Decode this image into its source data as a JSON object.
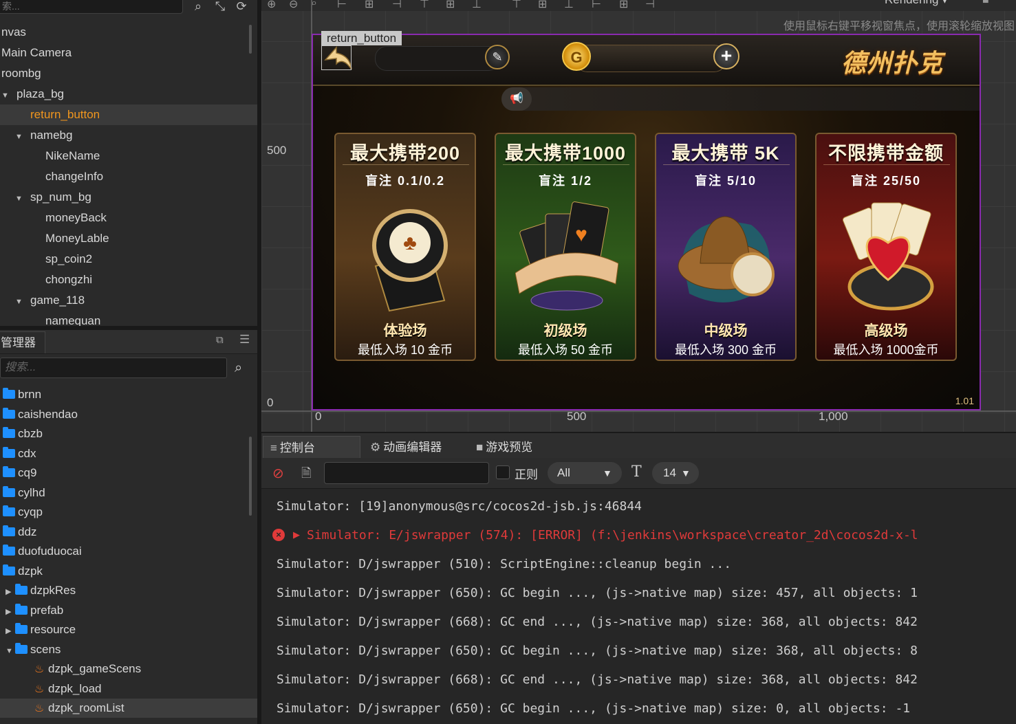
{
  "hierarchy": {
    "search_placeholder": "索...",
    "items": [
      {
        "label": "nvas",
        "indent": 0,
        "caret": ""
      },
      {
        "label": "Main Camera",
        "indent": 0,
        "caret": ""
      },
      {
        "label": "roombg",
        "indent": 0,
        "caret": ""
      },
      {
        "label": "plaza_bg",
        "indent": 0,
        "caret": "▼"
      },
      {
        "label": "return_button",
        "indent": 1,
        "caret": "",
        "selected": true
      },
      {
        "label": "namebg",
        "indent": 1,
        "caret": "▼"
      },
      {
        "label": "NikeName",
        "indent": 2,
        "caret": ""
      },
      {
        "label": "changeInfo",
        "indent": 2,
        "caret": ""
      },
      {
        "label": "sp_num_bg",
        "indent": 1,
        "caret": "▼"
      },
      {
        "label": "moneyBack",
        "indent": 2,
        "caret": ""
      },
      {
        "label": "MoneyLable",
        "indent": 2,
        "caret": ""
      },
      {
        "label": "sp_coin2",
        "indent": 2,
        "caret": ""
      },
      {
        "label": "chongzhi",
        "indent": 2,
        "caret": ""
      },
      {
        "label": "game_118",
        "indent": 1,
        "caret": "▼"
      },
      {
        "label": "namequan",
        "indent": 2,
        "caret": ""
      }
    ]
  },
  "assets": {
    "tab_label": "管理器",
    "search_placeholder": "搜索...",
    "items": [
      {
        "label": "brnn",
        "type": "folder",
        "indent": 0
      },
      {
        "label": "caishendao",
        "type": "folder",
        "indent": 0
      },
      {
        "label": "cbzb",
        "type": "folder",
        "indent": 0
      },
      {
        "label": "cdx",
        "type": "folder",
        "indent": 0
      },
      {
        "label": "cq9",
        "type": "folder",
        "indent": 0
      },
      {
        "label": "cylhd",
        "type": "folder",
        "indent": 0
      },
      {
        "label": "cyqp",
        "type": "folder",
        "indent": 0
      },
      {
        "label": "ddz",
        "type": "folder",
        "indent": 0
      },
      {
        "label": "duofuduocai",
        "type": "folder",
        "indent": 0
      },
      {
        "label": "dzpk",
        "type": "folder",
        "indent": 0
      },
      {
        "label": "dzpkRes",
        "type": "folder",
        "indent": 1,
        "caret": "▶"
      },
      {
        "label": "prefab",
        "type": "folder",
        "indent": 1,
        "caret": "▶"
      },
      {
        "label": "resource",
        "type": "folder",
        "indent": 1,
        "caret": "▶"
      },
      {
        "label": "scens",
        "type": "folder",
        "indent": 1,
        "caret": "▼"
      },
      {
        "label": "dzpk_gameScens",
        "type": "scene",
        "indent": 2
      },
      {
        "label": "dzpk_load",
        "type": "scene",
        "indent": 2
      },
      {
        "label": "dzpk_roomList",
        "type": "scene",
        "indent": 2,
        "selected": true
      }
    ]
  },
  "scene": {
    "hint": "使用鼠标右键平移视窗焦点，使用滚轮缩放视图",
    "render_menu": "Rendering ▾",
    "axis": {
      "y500": "500",
      "y0": "0",
      "x0": "0",
      "x500": "500",
      "x1000": "1,000"
    },
    "node_label": "return_button",
    "game": {
      "title": "德州扑克",
      "coin_glyph": "G",
      "plus_glyph": "+",
      "edit_glyph": "✎",
      "speaker_glyph": "📢",
      "version": "1.01",
      "cards": [
        {
          "title": "最大携带200",
          "blind": "盲注 0.1/0.2",
          "name": "体验场",
          "min": "最低入场 10 金币"
        },
        {
          "title": "最大携带1000",
          "blind": "盲注 1/2",
          "name": "初级场",
          "min": "最低入场 50 金币"
        },
        {
          "title": "最大携带 5K",
          "blind": "盲注 5/10",
          "name": "中级场",
          "min": "最低入场 300 金币"
        },
        {
          "title": "不限携带金额",
          "blind": "盲注 25/50",
          "name": "高级场",
          "min": "最低入场 1000金币"
        }
      ]
    }
  },
  "console": {
    "tabs": [
      {
        "label": "控制台",
        "icon": "≡"
      },
      {
        "label": "动画编辑器",
        "icon": "⚙"
      },
      {
        "label": "游戏预览",
        "icon": "■"
      }
    ],
    "regex_label": "正则",
    "level": "All",
    "font_size": "14",
    "lines": [
      {
        "text": "Simulator: [19]anonymous@src/cocos2d-jsb.js:46844",
        "level": "log"
      },
      {
        "text": "Simulator: E/jswrapper (574): [ERROR] (f:\\jenkins\\workspace\\creator_2d\\cocos2d-x-l",
        "level": "error"
      },
      {
        "text": "Simulator: D/jswrapper (510): ScriptEngine::cleanup begin ...",
        "level": "log"
      },
      {
        "text": "Simulator: D/jswrapper (650): GC begin ..., (js->native map) size: 457, all objects: 1",
        "level": "log"
      },
      {
        "text": "Simulator: D/jswrapper (668): GC end ..., (js->native map) size: 368, all objects: 842",
        "level": "log"
      },
      {
        "text": "Simulator: D/jswrapper (650): GC begin ..., (js->native map) size: 368, all objects: 8",
        "level": "log"
      },
      {
        "text": "Simulator: D/jswrapper (668): GC end ..., (js->native map) size: 368, all objects: 842",
        "level": "log"
      },
      {
        "text": "Simulator: D/jswrapper (650): GC begin ..., (js->native map) size: 0, all objects: -1",
        "level": "log"
      }
    ]
  }
}
